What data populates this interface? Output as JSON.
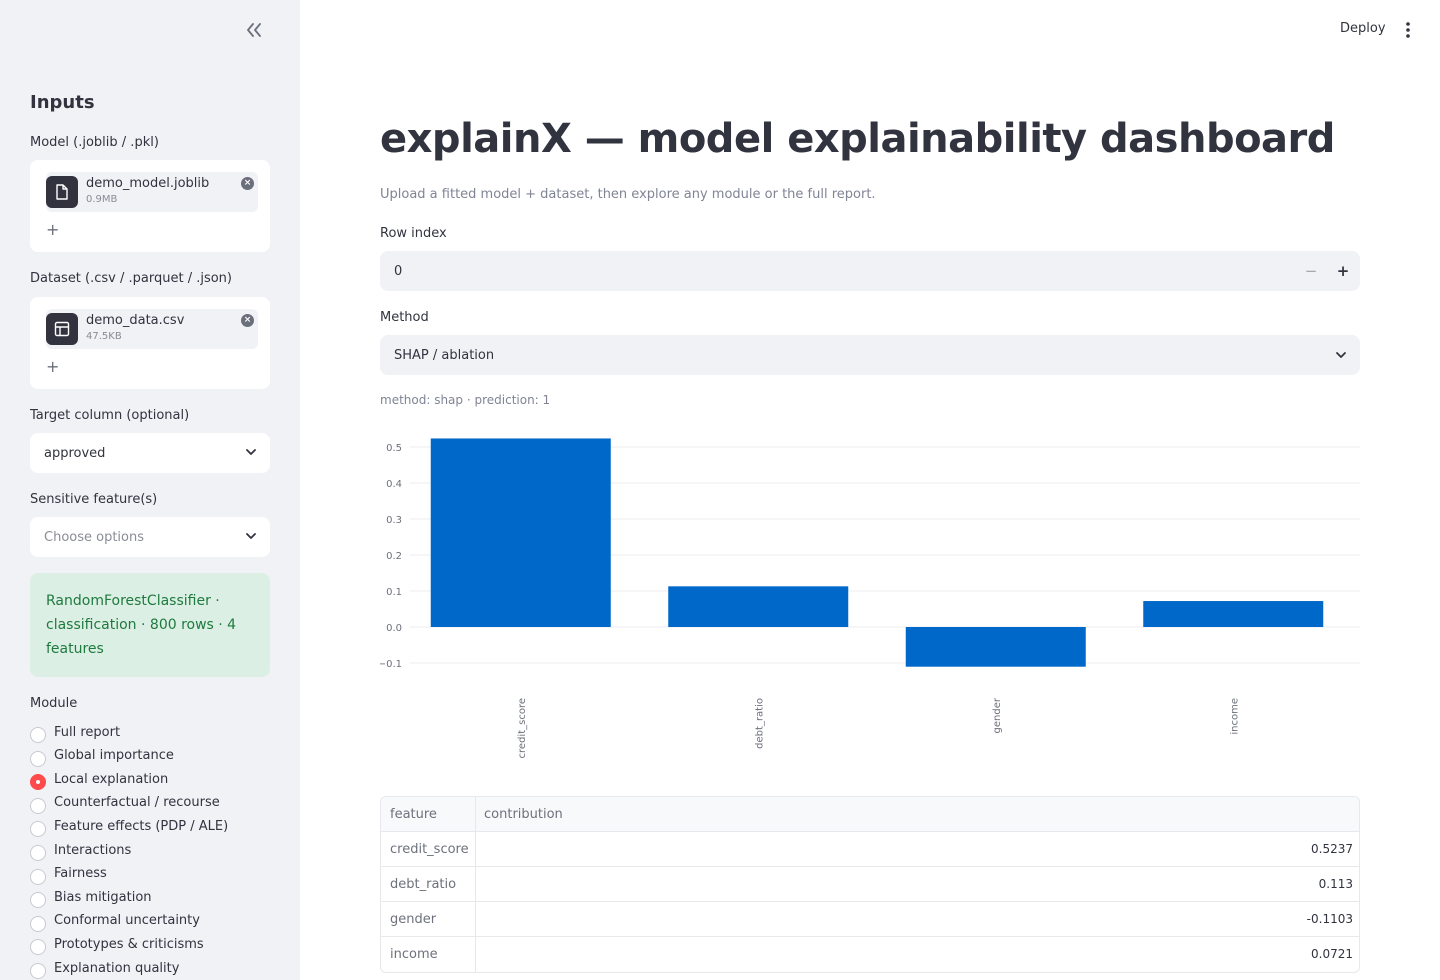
{
  "sidebar": {
    "heading": "Inputs",
    "model_label": "Model (.joblib / .pkl)",
    "model_file": {
      "name": "demo_model.joblib",
      "size": "0.9MB"
    },
    "dataset_label": "Dataset (.csv / .parquet / .json)",
    "dataset_file": {
      "name": "demo_data.csv",
      "size": "47.5KB"
    },
    "add_more": "+",
    "target_label": "Target column (optional)",
    "target_value": "approved",
    "sensitive_label": "Sensitive feature(s)",
    "sensitive_placeholder": "Choose options",
    "info_text": "RandomForestClassifier · classification · 800 rows · 4 features",
    "module_label": "Module",
    "modules": [
      {
        "label": "Full report",
        "checked": false
      },
      {
        "label": "Global importance",
        "checked": false
      },
      {
        "label": "Local explanation",
        "checked": true
      },
      {
        "label": "Counterfactual / recourse",
        "checked": false
      },
      {
        "label": "Feature effects (PDP / ALE)",
        "checked": false
      },
      {
        "label": "Interactions",
        "checked": false
      },
      {
        "label": "Fairness",
        "checked": false
      },
      {
        "label": "Bias mitigation",
        "checked": false
      },
      {
        "label": "Conformal uncertainty",
        "checked": false
      },
      {
        "label": "Prototypes & criticisms",
        "checked": false
      },
      {
        "label": "Explanation quality",
        "checked": false
      }
    ]
  },
  "header": {
    "deploy_label": "Deploy"
  },
  "main": {
    "title": "explainX — model explainability dashboard",
    "subtitle": "Upload a fitted model + dataset, then explore any module or the full report.",
    "row_index_label": "Row index",
    "row_index_value": "0",
    "decrement": "−",
    "increment": "+",
    "method_label": "Method",
    "method_value": "SHAP / ablation",
    "caption": "method: shap · prediction: 1"
  },
  "chart_data": {
    "type": "bar",
    "categories": [
      "credit_score",
      "debt_ratio",
      "gender",
      "income"
    ],
    "values": [
      0.5237,
      0.113,
      -0.1103,
      0.0721
    ],
    "yticks": [
      -0.1,
      0.0,
      0.1,
      0.2,
      0.3,
      0.4,
      0.5
    ],
    "ytick_labels": [
      "−0.1",
      "0.0",
      "0.1",
      "0.2",
      "0.3",
      "0.4",
      "0.5"
    ],
    "ylim": [
      -0.1,
      0.5
    ],
    "bar_color": "#0068c9",
    "grid": true,
    "legend": "none"
  },
  "table": {
    "columns": [
      "feature",
      "contribution"
    ],
    "rows": [
      [
        "credit_score",
        "0.5237"
      ],
      [
        "debt_ratio",
        "0.113"
      ],
      [
        "gender",
        "-0.1103"
      ],
      [
        "income",
        "0.0721"
      ]
    ]
  },
  "colors": {
    "accent": "#ff4b4b",
    "bar": "#0068c9",
    "success_bg": "#dcefe4",
    "success_text": "#1f7a3e"
  }
}
